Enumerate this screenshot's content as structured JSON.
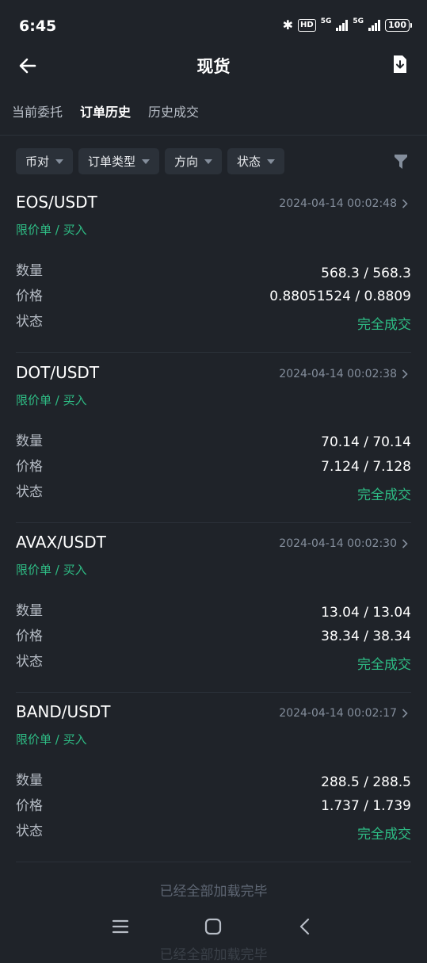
{
  "status_bar": {
    "time": "6:45",
    "hd": "HD",
    "network1": "5G",
    "network2": "5G",
    "battery": "100"
  },
  "header": {
    "title": "现货"
  },
  "tabs": [
    {
      "label": "当前委托",
      "active": false
    },
    {
      "label": "订单历史",
      "active": true
    },
    {
      "label": "历史成交",
      "active": false
    }
  ],
  "filters": [
    {
      "label": "币对"
    },
    {
      "label": "订单类型"
    },
    {
      "label": "方向"
    },
    {
      "label": "状态"
    }
  ],
  "field_labels": {
    "quantity": "数量",
    "price": "价格",
    "status": "状态"
  },
  "orders": [
    {
      "pair": "EOS/USDT",
      "time": "2024-04-14 00:02:48",
      "type": "限价单 / 买入",
      "quantity": "568.3 / 568.3",
      "price": "0.88051524 / 0.8809",
      "status": "完全成交"
    },
    {
      "pair": "DOT/USDT",
      "time": "2024-04-14 00:02:38",
      "type": "限价单 / 买入",
      "quantity": "70.14 / 70.14",
      "price": "7.124 / 7.128",
      "status": "完全成交"
    },
    {
      "pair": "AVAX/USDT",
      "time": "2024-04-14 00:02:30",
      "type": "限价单 / 买入",
      "quantity": "13.04 / 13.04",
      "price": "38.34 / 38.34",
      "status": "完全成交"
    },
    {
      "pair": "BAND/USDT",
      "time": "2024-04-14 00:02:17",
      "type": "限价单 / 买入",
      "quantity": "288.5 / 288.5",
      "price": "1.737 / 1.739",
      "status": "完全成交"
    }
  ],
  "footer": {
    "loaded_text": "已经全部加载完毕",
    "loaded_ghost_text": "已经全部加载完毕"
  },
  "colors": {
    "background": "#1f2329",
    "buy_green": "#2ebd85",
    "muted": "#848e9c"
  }
}
